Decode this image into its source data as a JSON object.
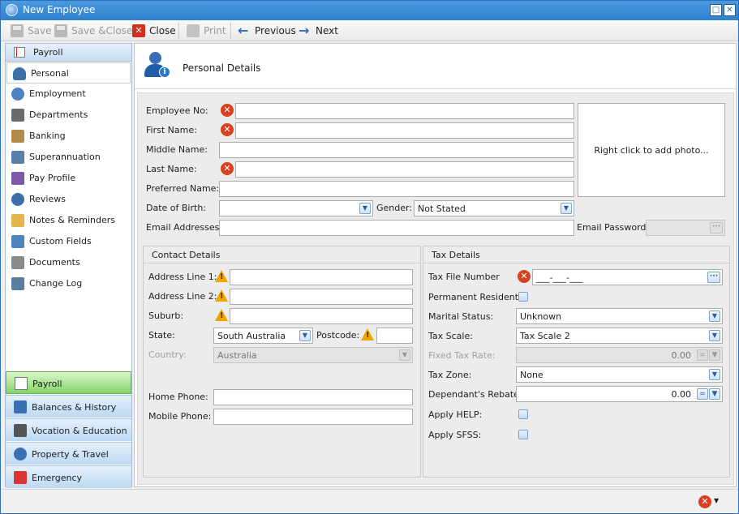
{
  "window": {
    "title": "New Employee"
  },
  "toolbar": {
    "save": "Save",
    "save_close": "Save &Close",
    "close": "Close",
    "print": "Print",
    "previous": "Previous",
    "next": "Next"
  },
  "sidebar": {
    "header": "Payroll",
    "items": [
      {
        "label": "Personal",
        "icon": "person-info-icon",
        "selected": true
      },
      {
        "label": "Employment",
        "icon": "people-network-icon"
      },
      {
        "label": "Departments",
        "icon": "building-icon"
      },
      {
        "label": "Banking",
        "icon": "bank-icon"
      },
      {
        "label": "Superannuation",
        "icon": "id-card-icon"
      },
      {
        "label": "Pay Profile",
        "icon": "pay-card-icon"
      },
      {
        "label": "Reviews",
        "icon": "people-icon"
      },
      {
        "label": "Notes & Reminders",
        "icon": "notes-icon"
      },
      {
        "label": "Custom Fields",
        "icon": "fields-icon"
      },
      {
        "label": "Documents",
        "icon": "folder-icon"
      },
      {
        "label": "Change Log",
        "icon": "log-icon"
      }
    ],
    "sections": [
      {
        "label": "Payroll",
        "active": true
      },
      {
        "label": "Balances & History"
      },
      {
        "label": "Vocation & Education"
      },
      {
        "label": "Property & Travel"
      },
      {
        "label": "Emergency"
      }
    ]
  },
  "header": {
    "title": "Personal Details"
  },
  "personal": {
    "employee_no_label": "Employee No:",
    "first_name_label": "First Name:",
    "middle_name_label": "Middle Name:",
    "last_name_label": "Last Name:",
    "preferred_name_label": "Preferred Name:",
    "dob_label": "Date of Birth:",
    "gender_label": "Gender:",
    "gender_value": "Not Stated",
    "email_label": "Email Addresses:",
    "email_password_label": "Email Password:",
    "photo_hint": "Right click to add photo..."
  },
  "contact": {
    "title": "Contact Details",
    "address1_label": "Address Line 1:",
    "address2_label": "Address Line 2:",
    "suburb_label": "Suburb:",
    "state_label": "State:",
    "state_value": "South Australia",
    "postcode_label": "Postcode:",
    "country_label": "Country:",
    "country_value": "Australia",
    "home_phone_label": "Home Phone:",
    "mobile_phone_label": "Mobile Phone:"
  },
  "tax": {
    "title": "Tax Details",
    "tfn_label": "Tax File Number",
    "tfn_value": "___-___-___",
    "permanent_resident_label": "Permanent Resident:",
    "marital_label": "Marital Status:",
    "marital_value": "Unknown",
    "scale_label": "Tax Scale:",
    "scale_value": "Tax Scale 2",
    "fixed_rate_label": "Fixed Tax Rate:",
    "fixed_rate_value": "0.00",
    "zone_label": "Tax Zone:",
    "zone_value": "None",
    "rebate_label": "Dependant's Rebate:",
    "rebate_value": "0.00",
    "help_label": "Apply HELP:",
    "sfss_label": "Apply SFSS:"
  },
  "colors": {
    "titlebar": "#2f7fcc",
    "error_red": "#d9401f",
    "warning_amber": "#f0a400",
    "active_section_green": "#86d56a"
  }
}
